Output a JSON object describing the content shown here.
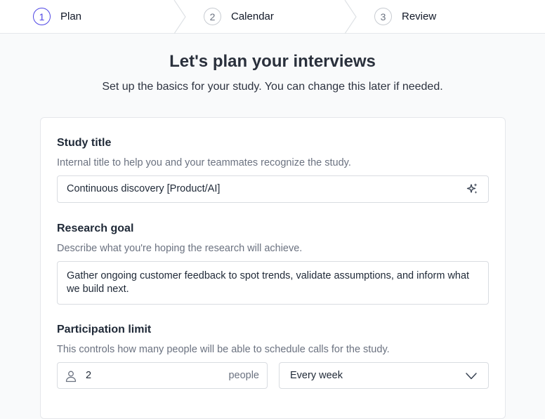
{
  "stepper": {
    "steps": [
      {
        "number": "1",
        "label": "Plan",
        "state": "active"
      },
      {
        "number": "2",
        "label": "Calendar",
        "state": "upcoming"
      },
      {
        "number": "3",
        "label": "Review",
        "state": "upcoming"
      }
    ],
    "accent_color": "#4f46e5"
  },
  "header": {
    "title": "Let's plan your interviews",
    "subtitle": "Set up the basics for your study. You can change this later if needed."
  },
  "form": {
    "study_title": {
      "label": "Study title",
      "help": "Internal title to help you and your teammates recognize the study.",
      "value": "Continuous discovery [Product/AI]",
      "icon": "sparkle-icon"
    },
    "research_goal": {
      "label": "Research goal",
      "help": "Describe what you're hoping the research will achieve.",
      "value": "Gather ongoing customer feedback to spot trends, validate assumptions, and inform what we build next."
    },
    "participation_limit": {
      "label": "Participation limit",
      "help": "This controls how many people will be able to schedule calls for the study.",
      "count_value": "2",
      "count_suffix": "people",
      "count_icon": "user-icon",
      "frequency_value": "Every week",
      "frequency_icon": "chevron-down-icon"
    }
  }
}
